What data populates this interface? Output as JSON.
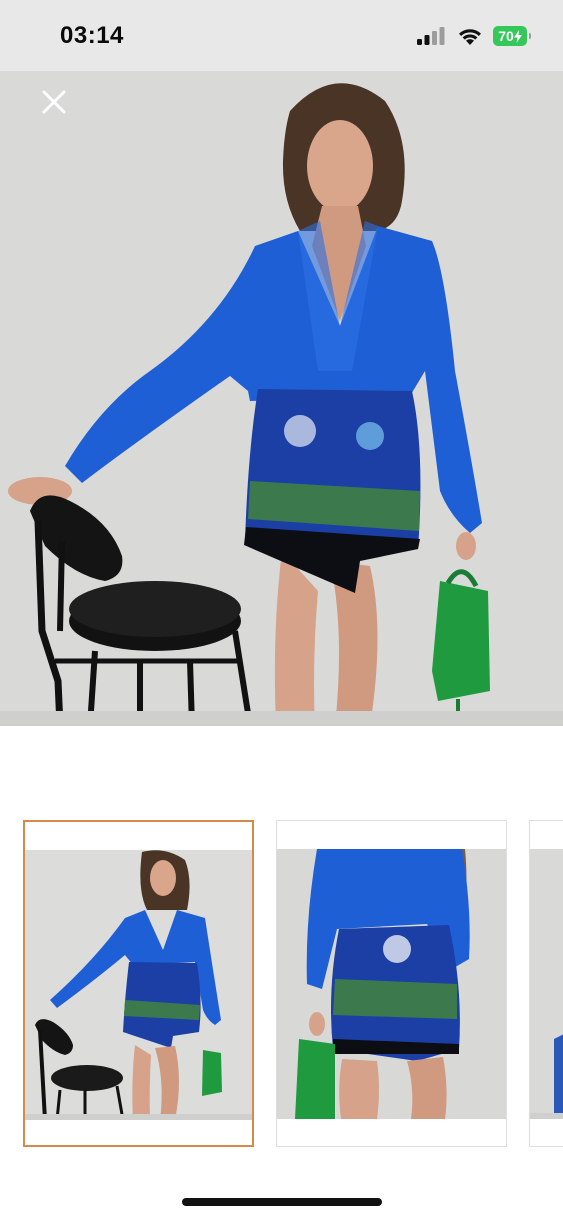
{
  "status_bar": {
    "time": "03:14",
    "battery_level": "70",
    "battery_color": "#34c759",
    "icons": [
      "cellular-signal-icon",
      "wifi-icon",
      "battery-icon"
    ]
  },
  "viewer": {
    "close_icon": "close-icon",
    "selected_thumbnail": 1,
    "thumbnail_count_visible": 3,
    "selected_border_color": "#d7894a"
  },
  "colors": {
    "shirt_blue": "#1f5fd6",
    "bag_green": "#1f9a3f",
    "wall": "#dcdcdb"
  }
}
